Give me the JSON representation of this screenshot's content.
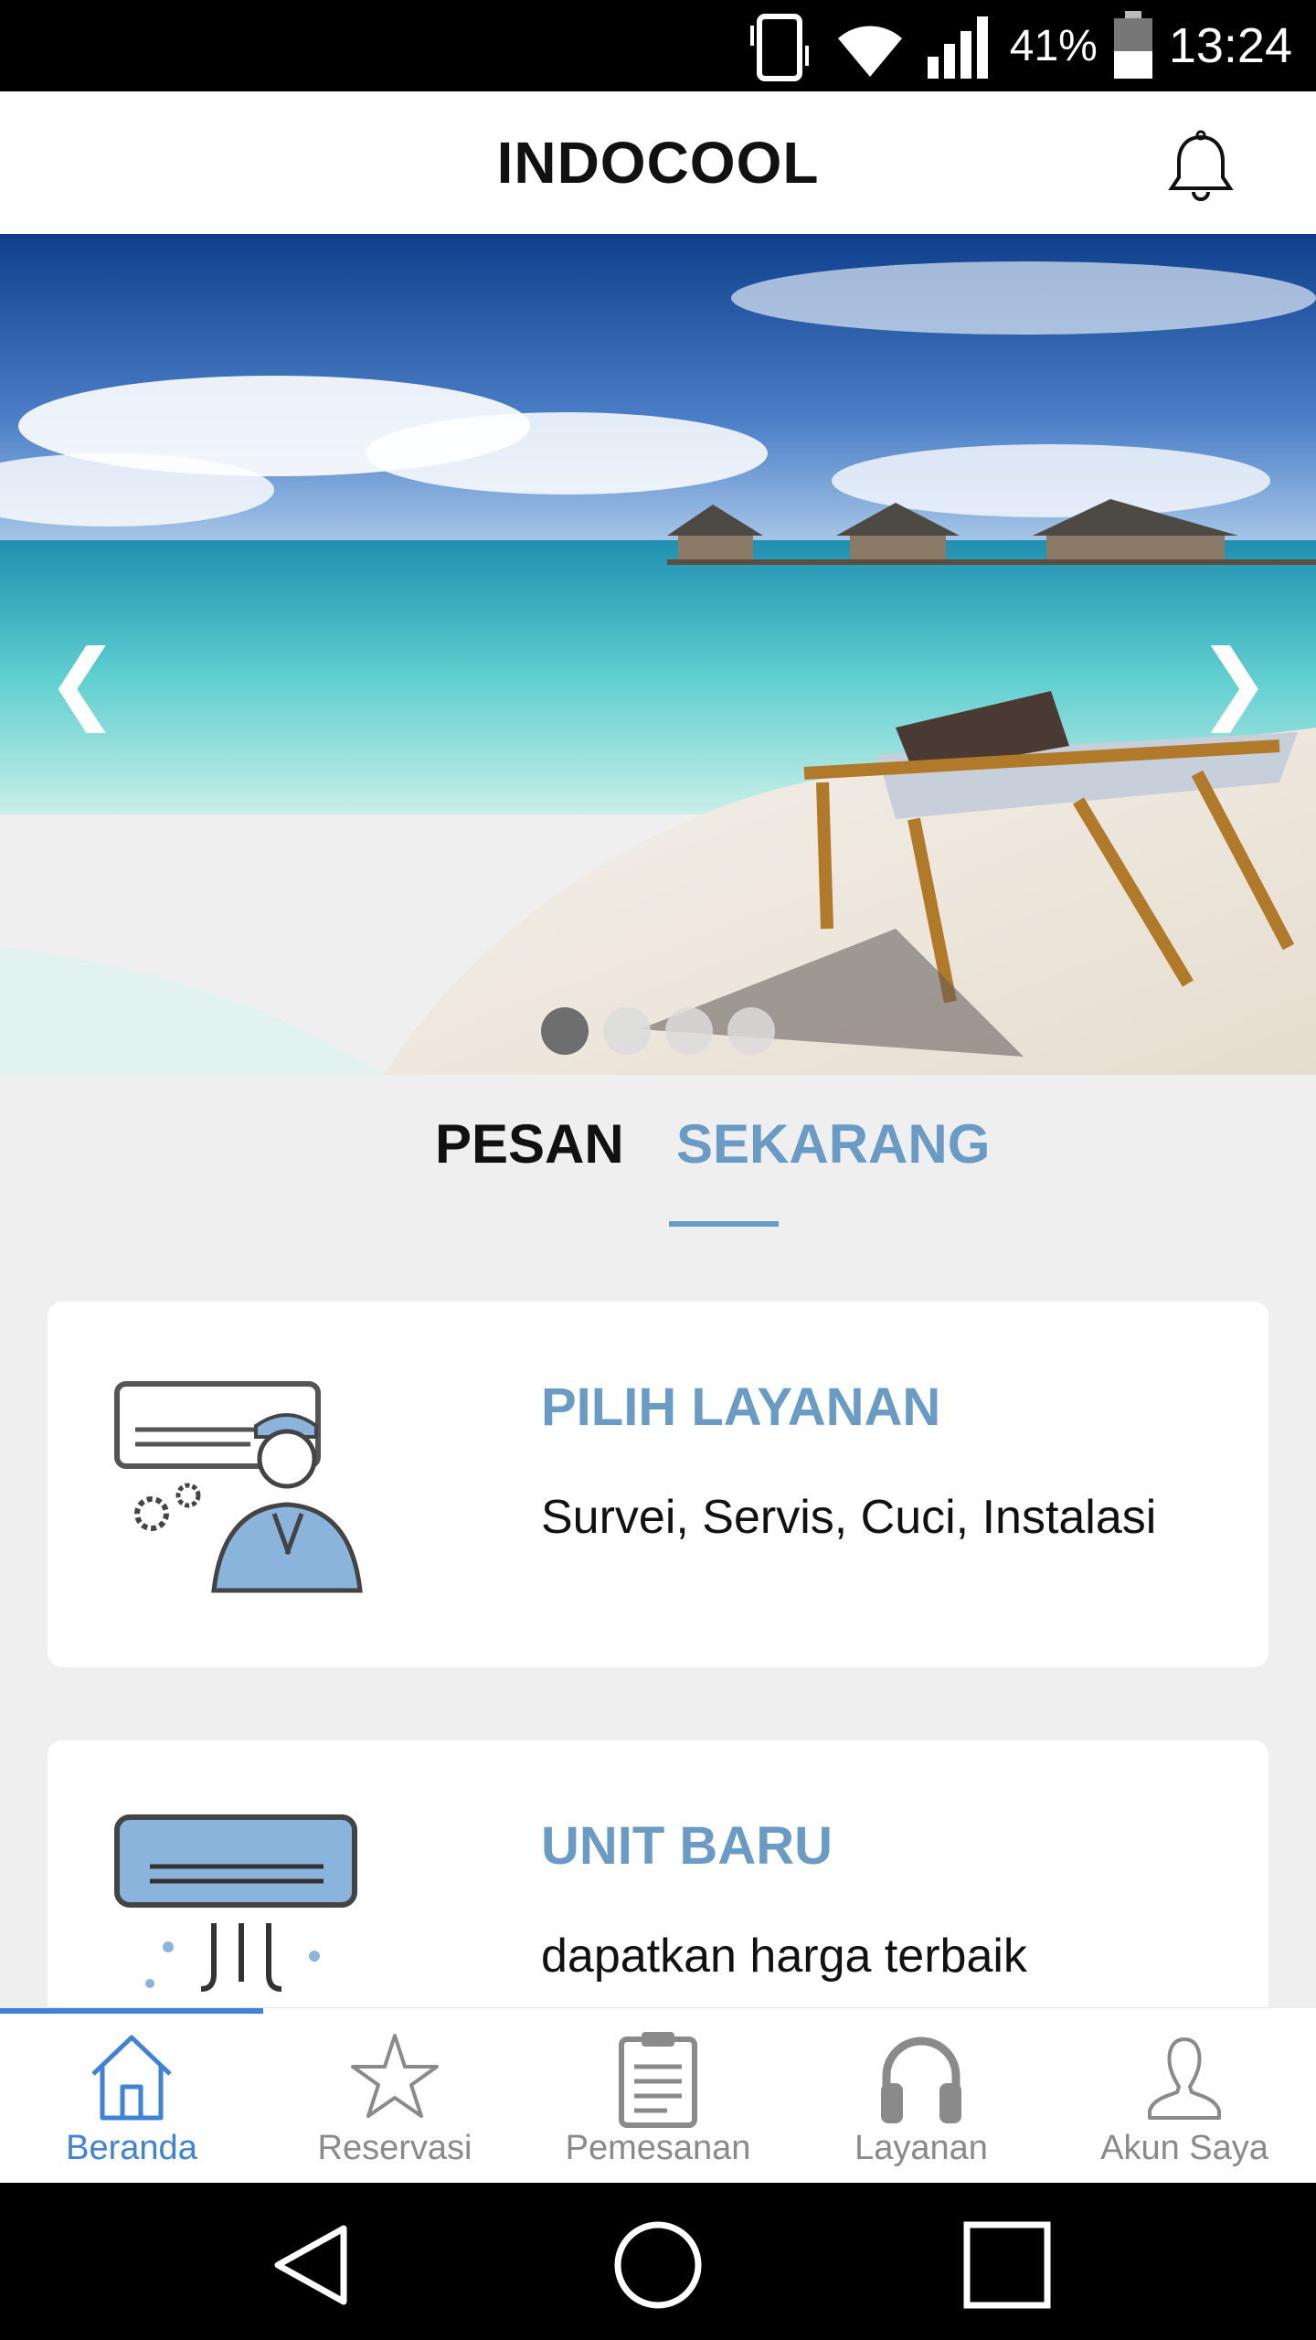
{
  "status_bar": {
    "battery_percent": "41%",
    "time": "13:24",
    "icons": [
      "vibrate-icon",
      "wifi-icon",
      "signal-icon",
      "battery-icon"
    ]
  },
  "header": {
    "title": "INDOCOOL",
    "notification_icon": "bell-icon"
  },
  "carousel": {
    "prev_glyph": "❮",
    "next_glyph": "❯",
    "slide_count": 4,
    "active_index": 0
  },
  "tabs": [
    {
      "label": "PESAN",
      "active": false
    },
    {
      "label": "SEKARANG",
      "active": true
    }
  ],
  "cards": [
    {
      "title": "PILIH LAYANAN",
      "subtitle": "Survei, Servis, Cuci, Instalasi",
      "icon": "technician-icon"
    },
    {
      "title": "UNIT BARU",
      "subtitle": "dapatkan harga terbaik",
      "icon": "air-conditioner-icon"
    }
  ],
  "bottom_nav": [
    {
      "label": "Beranda",
      "icon": "home-icon",
      "active": true
    },
    {
      "label": "Reservasi",
      "icon": "star-icon",
      "active": false
    },
    {
      "label": "Pemesanan",
      "icon": "clipboard-icon",
      "active": false
    },
    {
      "label": "Layanan",
      "icon": "headphones-icon",
      "active": false
    },
    {
      "label": "Akun Saya",
      "icon": "user-icon",
      "active": false
    }
  ],
  "colors": {
    "accent": "#6a9bc4",
    "nav_active": "#3f82d8",
    "background": "#efefef"
  }
}
